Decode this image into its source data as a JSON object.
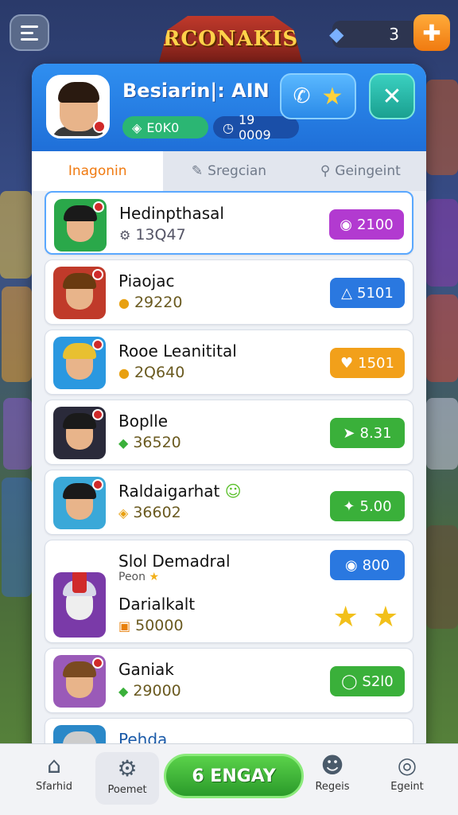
{
  "top_bar": {
    "logo_text": "RCONAKIS",
    "currency_value": "3",
    "add_button_icon": "plus-icon"
  },
  "profile": {
    "name": "Besiarin|: AIN",
    "stat_a": "E0K0",
    "stat_b": "19 0009",
    "call_icon": "phone-icon",
    "star_icon": "star-icon",
    "close_icon": "close-icon"
  },
  "tabs": [
    {
      "label": "Inagonin",
      "icon": ""
    },
    {
      "label": "Sregcian",
      "icon": "pen-icon"
    },
    {
      "label": "Geingeint",
      "icon": "search-icon"
    }
  ],
  "rows": [
    {
      "name": "Hedinpthasal",
      "score": "13Q47",
      "score_icon": "gear-icon",
      "score_color": "#555566",
      "action": "2100",
      "action_icon": "potion-icon",
      "action_color": "#b23ad0",
      "avatar_bg": "#2aa84a",
      "hair": "#1a1a1a"
    },
    {
      "name": "Piaojac",
      "score": "29220",
      "score_icon": "coin-icon",
      "score_color": "#6a5a20",
      "action": "5101",
      "action_icon": "drop-icon",
      "action_color": "#2a78e0",
      "avatar_bg": "#c03a2a",
      "hair": "#6a3a10"
    },
    {
      "name": "Rooe Leanitital",
      "score": "2Q640",
      "score_icon": "coin-icon",
      "score_color": "#6a5a20",
      "action": "1501",
      "action_icon": "heart-icon",
      "action_color": "#f2a01a",
      "avatar_bg": "#2a98e0",
      "hair": "#e8c030"
    },
    {
      "name": "Boplle",
      "score": "36520",
      "score_icon": "gem-icon",
      "score_color": "#6a5a20",
      "action": "8.31",
      "action_icon": "arrow-icon",
      "action_color": "#3ab03a",
      "avatar_bg": "#2a2a3a",
      "hair": "#1a1a1a"
    },
    {
      "name": "Raldaigarhat",
      "score": "36602",
      "score_icon": "shield-icon",
      "score_color": "#6a5a20",
      "action": "5.00",
      "action_icon": "sparkle-icon",
      "action_color": "#3ab03a",
      "avatar_bg": "#3aa8d8",
      "hair": "#1a1a1a"
    },
    {
      "name": "Slol Demadral",
      "sub": "Peon",
      "name2": "Darialkalt",
      "score": "50000",
      "score_icon": "chest-icon",
      "score_color": "#6a5a20",
      "action": "800",
      "action_icon": "potion-icon",
      "action_color": "#2a78e0",
      "avatar_bg": "#7a3aa8",
      "hair": "#d8d8e8"
    },
    {
      "name": "Ganiak",
      "score": "29000",
      "score_icon": "gem-icon",
      "score_color": "#6a5a20",
      "action": "S2l0",
      "action_icon": "ring-icon",
      "action_color": "#3ab03a",
      "avatar_bg": "#9a5ab8",
      "hair": "#7a4a20"
    },
    {
      "name": "Pehda",
      "score": "",
      "score_icon": "",
      "score_color": "#6a5a20",
      "action": "",
      "action_icon": "",
      "action_color": "#3ab03a",
      "avatar_bg": "#2a88c8",
      "hair": "#cccccc"
    }
  ],
  "bottom_nav": {
    "items": [
      {
        "label": "Sfarhid",
        "icon": "home-icon"
      },
      {
        "label": "Poemet",
        "icon": "gear-icon"
      },
      {
        "label": "Regeis",
        "icon": "user-icon"
      },
      {
        "label": "Egeint",
        "icon": "camera-icon"
      }
    ],
    "play_label": "6 ENGAY"
  }
}
